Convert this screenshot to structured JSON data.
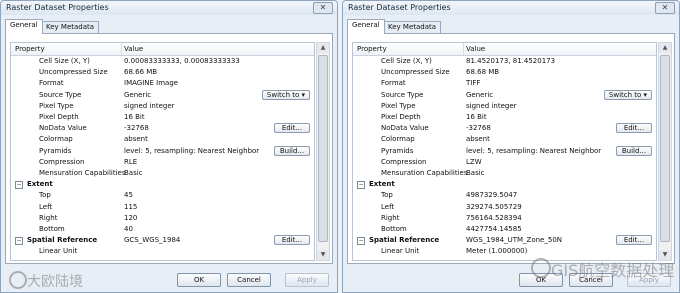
{
  "dialogs": [
    {
      "title": "Raster Dataset Properties",
      "tabs": [
        "General",
        "Key Metadata"
      ],
      "columns": [
        "Property",
        "Value"
      ],
      "rows": [
        {
          "type": "prop",
          "key": "Cell Size (X, Y)",
          "value": "0.00083333333, 0.00083333333"
        },
        {
          "type": "prop",
          "key": "Uncompressed Size",
          "value": "68.66 MB"
        },
        {
          "type": "prop",
          "key": "Format",
          "value": "IMAGINE Image"
        },
        {
          "type": "prop",
          "key": "Source Type",
          "value": "Generic",
          "button": "Switch to ▾",
          "btn": "switch"
        },
        {
          "type": "prop",
          "key": "Pixel Type",
          "value": "signed integer"
        },
        {
          "type": "prop",
          "key": "Pixel Depth",
          "value": "16 Bit"
        },
        {
          "type": "prop",
          "key": "NoData Value",
          "value": "-32768",
          "button": "Edit...",
          "btn": "edit"
        },
        {
          "type": "prop",
          "key": "Colormap",
          "value": "absent"
        },
        {
          "type": "prop",
          "key": "Pyramids",
          "value": "level: 5, resampling: Nearest Neighbor",
          "button": "Build...",
          "btn": "build"
        },
        {
          "type": "prop",
          "key": "Compression",
          "value": "RLE"
        },
        {
          "type": "prop",
          "key": "Mensuration Capabilities",
          "value": "Basic"
        },
        {
          "type": "section",
          "key": "Extent",
          "value": ""
        },
        {
          "type": "prop",
          "key": "Top",
          "value": "45"
        },
        {
          "type": "prop",
          "key": "Left",
          "value": "115"
        },
        {
          "type": "prop",
          "key": "Right",
          "value": "120"
        },
        {
          "type": "prop",
          "key": "Bottom",
          "value": "40"
        },
        {
          "type": "section",
          "key": "Spatial Reference",
          "value": "GCS_WGS_1984",
          "button": "Edit...",
          "btn": "edit"
        },
        {
          "type": "prop",
          "key": "Linear Unit",
          "value": ""
        }
      ],
      "buttons": {
        "ok": "OK",
        "cancel": "Cancel",
        "apply": "Apply"
      },
      "watermark": "大欧陆境"
    },
    {
      "title": "Raster Dataset Properties",
      "tabs": [
        "General",
        "Key Metadata"
      ],
      "columns": [
        "Property",
        "Value"
      ],
      "rows": [
        {
          "type": "prop",
          "key": "Cell Size (X, Y)",
          "value": "81.4520173, 81.4520173"
        },
        {
          "type": "prop",
          "key": "Uncompressed Size",
          "value": "68.68 MB"
        },
        {
          "type": "prop",
          "key": "Format",
          "value": "TIFF"
        },
        {
          "type": "prop",
          "key": "Source Type",
          "value": "Generic",
          "button": "Switch to ▾",
          "btn": "switch"
        },
        {
          "type": "prop",
          "key": "Pixel Type",
          "value": "signed integer"
        },
        {
          "type": "prop",
          "key": "Pixel Depth",
          "value": "16 Bit"
        },
        {
          "type": "prop",
          "key": "NoData Value",
          "value": "-32768",
          "button": "Edit...",
          "btn": "edit"
        },
        {
          "type": "prop",
          "key": "Colormap",
          "value": "absent"
        },
        {
          "type": "prop",
          "key": "Pyramids",
          "value": "level: 5, resampling: Nearest Neighbor",
          "button": "Build...",
          "btn": "build"
        },
        {
          "type": "prop",
          "key": "Compression",
          "value": "LZW"
        },
        {
          "type": "prop",
          "key": "Mensuration Capabilities",
          "value": "Basic"
        },
        {
          "type": "section",
          "key": "Extent",
          "value": ""
        },
        {
          "type": "prop",
          "key": "Top",
          "value": "4987329.5047"
        },
        {
          "type": "prop",
          "key": "Left",
          "value": "329274.505729"
        },
        {
          "type": "prop",
          "key": "Right",
          "value": "756164.528394"
        },
        {
          "type": "prop",
          "key": "Bottom",
          "value": "4427754.14585"
        },
        {
          "type": "section",
          "key": "Spatial Reference",
          "value": "WGS_1984_UTM_Zone_50N",
          "button": "Edit...",
          "btn": "edit"
        },
        {
          "type": "prop",
          "key": "Linear Unit",
          "value": "Meter (1.000000)"
        }
      ],
      "buttons": {
        "ok": "OK",
        "cancel": "Cancel",
        "apply": "Apply"
      },
      "watermark": "GIS航空数据处理"
    }
  ]
}
